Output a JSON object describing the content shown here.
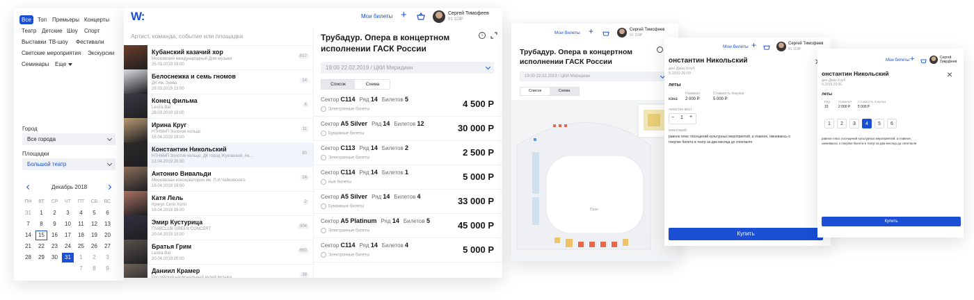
{
  "filters": {
    "categories": [
      "Все",
      "Топ",
      "Премьеры",
      "Концерты",
      "Театр",
      "Детские",
      "Шоу",
      "Спорт",
      "Выставки",
      "ТВ-шоу",
      "Фестивали",
      "Светские мероприятия",
      "Экскурсии",
      "Семинары",
      "Еще"
    ],
    "city_label": "Город",
    "city_value": "Все города",
    "venue_label": "Площадки",
    "venue_value": "Большой театр",
    "calendar": {
      "month": "Декабрь 2018",
      "weekdays": [
        "ПН",
        "ВТ",
        "СР",
        "ЧТ",
        "ПТ",
        "СБ",
        "ВС"
      ],
      "days": [
        "31",
        "1",
        "2",
        "3",
        "4",
        "5",
        "6",
        "7",
        "8",
        "9",
        "10",
        "11",
        "12",
        "13",
        "14",
        "15",
        "16",
        "17",
        "18",
        "19",
        "20",
        "21",
        "22",
        "23",
        "24",
        "25",
        "26",
        "27",
        "28",
        "29",
        "30",
        "31",
        "1",
        "2",
        "3"
      ],
      "extra_row": [
        "7",
        "8",
        "9"
      ]
    }
  },
  "header": {
    "logo": "W:",
    "my_tickets": "Мои билеты",
    "user_name": "Сергей Тимофеев",
    "user_sub": "91 119Р"
  },
  "search": {
    "placeholder": "Артист, команда, событие или площадка"
  },
  "events": [
    {
      "title": "Кубанский казачий хор",
      "place": "Московский международный Дом музыки",
      "date": "25.03.2019  19:00",
      "count": "817"
    },
    {
      "title": "Белоснежка и семь гномов",
      "place": "ДК им. Зуева",
      "date": "28.03.2019  13:00",
      "count": "14"
    },
    {
      "title": "Конец фильма",
      "place": "Lestra Bar",
      "date": "28.03.2019  19:00",
      "count": "4"
    },
    {
      "title": "Ирина Круг",
      "place": "НТНМиП Золотое кольцо",
      "date": "15.04.2019  19:00",
      "count": "11"
    },
    {
      "title": "Константин Никольский",
      "place": "НТНМиП Золотое кольцо, ДК город Жуковский, Ак...",
      "date": "12.04.2019  20:30",
      "count": "80"
    },
    {
      "title": "Антонио Вивальди",
      "place": "Московская консерватория им. П.И.Чайковского",
      "date": "16.04.2019  19:00",
      "count": "14"
    },
    {
      "title": "Катя Лель",
      "place": "Крокус Сити Холл",
      "date": "16.04.2019  19:00",
      "count": "2"
    },
    {
      "title": "Эмир Кустурица",
      "place": "ГЛАВCLUB GREEN CONCERT",
      "date": "20.04.2019  19:00",
      "count": "304"
    },
    {
      "title": "Братья Грим",
      "place": "Lestra Bar",
      "date": "20.04.2019  20:00",
      "count": "650"
    },
    {
      "title": "Даниил Крамер",
      "place": "Российский национальный музей музыки",
      "date": "",
      "count": "28"
    }
  ],
  "detail": {
    "title": "Трубадур. Опера в концертном исполнении ГАСК России",
    "session": "19:00 22.02.2019 / ЦКИ Меридиан",
    "tab_list": "Список",
    "tab_scheme": "Схема",
    "labels": {
      "sector": "Сектор",
      "row": "Ряд",
      "tickets": "Билетов"
    },
    "tickets": [
      {
        "sector": "C114",
        "row": "14",
        "count": "5",
        "type": "Электронные билеты",
        "price": "4 500 Р"
      },
      {
        "sector": "A5 Silver",
        "row": "14",
        "count": "12",
        "type": "Бумажные билеты",
        "price": "30 000 Р"
      },
      {
        "sector": "C113",
        "row": "14",
        "count": "2",
        "type": "Электронные билеты",
        "price": "2 500 Р"
      },
      {
        "sector": "C114",
        "row": "14",
        "count": "1",
        "type": "ные билеты",
        "price": "5 000 Р"
      },
      {
        "sector": "A5 Silver",
        "row": "14",
        "count": "4",
        "type": "Бумажные билеты",
        "price": "33 000 Р"
      },
      {
        "sector": "A5 Platinum",
        "row": "14",
        "count": "5",
        "type": "Электронные билеты",
        "price": "45 000 Р"
      },
      {
        "sector": "C114",
        "row": "14",
        "count": "4",
        "type": "Электронные билеты",
        "price": "5 000 Р"
      }
    ]
  },
  "scheme_panel": {
    "my_tickets": "Мои билеты",
    "user_name": "Сергей Тимофеев",
    "user_sub": "91 119Р",
    "title": "Трубадур. Опера в концертном исполнении ГАСК России",
    "session": "19:00 22.02.2019 / ЦКИ Меридиан",
    "tab_list": "Список",
    "tab_scheme": "Схема",
    "stage_label": "Поле"
  },
  "detail_panel": {
    "my_tickets": "Мои билеты",
    "user_name": "Сергей Тимофеев",
    "user_sub": "91 119Р",
    "title": "онстантин Никольский",
    "sub1": "ден Джаз Клуб",
    "sub2": "9.2019 20:00",
    "tickets_heading": "леты",
    "col_nominal": "Номинал",
    "col_price": "Стоимость покупки",
    "row_name": "кона",
    "nominal": "2 000 Р",
    "price": "5 000 Р",
    "qty_label": "личество мест",
    "qty_value": "1",
    "comment_label": "мментарий",
    "comment": "равное плюс посещений культурных мероприятий, а главное, омневаюсь о покупке билета в театр за два месяца до спектакля",
    "buy": "Купить"
  },
  "small_panel": {
    "my_tickets": "Мои билеты",
    "user_name": "Сергей Тимофеев",
    "user_sub": "91 119Р",
    "title": "онстантин Никольский",
    "sub1": "ден Джаз Клуб",
    "sub2": "9.2019 20:00",
    "tickets_heading": "леты",
    "cols": [
      "Ряд",
      "Номинал",
      "Стоимость покупки"
    ],
    "vals": [
      "15",
      "2 000 Р",
      "5 000 Р"
    ],
    "qty": [
      "1",
      "2",
      "3",
      "4",
      "5",
      "6"
    ],
    "comment": "равное плюс посещений культурных мероприятий, а главное, омневаюсь о покупке билета в театр за два месяца до спектакля",
    "buy": "Купить"
  },
  "colors": {
    "accent": "#1a4fd6",
    "text": "#16161a",
    "muted": "#9a9aa3"
  }
}
